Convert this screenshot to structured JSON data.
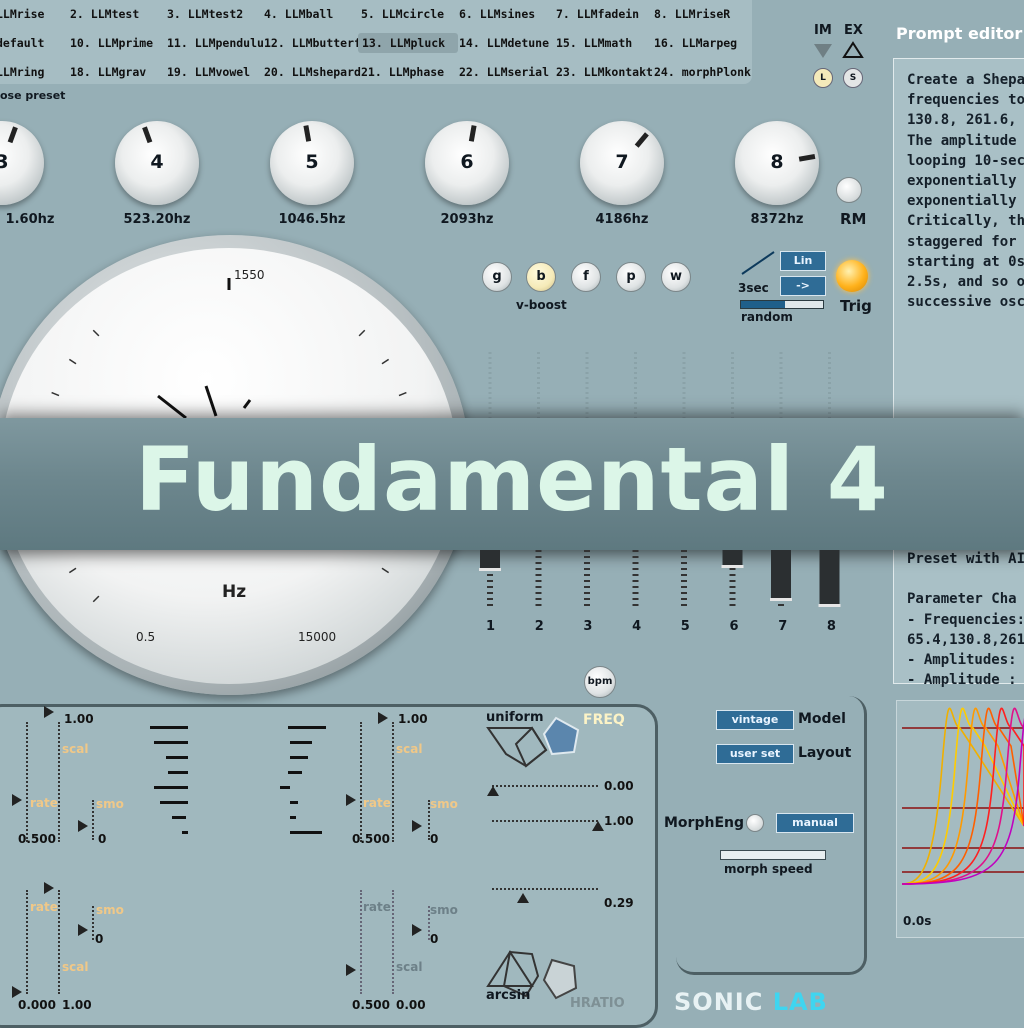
{
  "presets": [
    {
      "num": "",
      "name": "LLMrise"
    },
    {
      "num": "2.",
      "name": "LLMtest"
    },
    {
      "num": "3.",
      "name": "LLMtest2"
    },
    {
      "num": "4.",
      "name": "LLMball"
    },
    {
      "num": "5.",
      "name": "LLMcircle"
    },
    {
      "num": "6.",
      "name": "LLMsines"
    },
    {
      "num": "7.",
      "name": "LLMfadein"
    },
    {
      "num": "8.",
      "name": "LLMriseR"
    },
    {
      "num": "",
      "name": "default"
    },
    {
      "num": "10.",
      "name": "LLMprime"
    },
    {
      "num": "11.",
      "name": "LLMpendulu"
    },
    {
      "num": "12.",
      "name": "LLMbutterf"
    },
    {
      "num": "13.",
      "name": "LLMpluck"
    },
    {
      "num": "14.",
      "name": "LLMdetune"
    },
    {
      "num": "15.",
      "name": "LLMmath"
    },
    {
      "num": "16.",
      "name": "LLMarpeg"
    },
    {
      "num": "",
      "name": "LLMring"
    },
    {
      "num": "18.",
      "name": "LLMgrav"
    },
    {
      "num": "19.",
      "name": "LLMvowel"
    },
    {
      "num": "20.",
      "name": "LLMshepard"
    },
    {
      "num": "21.",
      "name": "LLMphase"
    },
    {
      "num": "22.",
      "name": "LLMserial"
    },
    {
      "num": "23.",
      "name": "LLMkontakt"
    },
    {
      "num": "24.",
      "name": "morphPlonk"
    }
  ],
  "selected_preset": "LLMpluck",
  "choose_preset_label": "ose preset",
  "im_label": "IM",
  "ex_label": "EX",
  "l_button": "L",
  "s_button": "S",
  "knobs": [
    {
      "num": "3",
      "freq": "1.60hz"
    },
    {
      "num": "4",
      "freq": "523.20hz"
    },
    {
      "num": "5",
      "freq": "1046.5hz"
    },
    {
      "num": "6",
      "freq": "2093hz"
    },
    {
      "num": "7",
      "freq": "4186hz"
    },
    {
      "num": "8",
      "freq": "8372hz"
    }
  ],
  "rm_label": "RM",
  "gauge": {
    "top_label": "1550",
    "unit": "Hz",
    "low_label": "0.5",
    "high_label": "15000"
  },
  "vboost": {
    "buttons": [
      "g",
      "b",
      "f",
      "p",
      "w"
    ],
    "active": "b",
    "label": "v-boost"
  },
  "lin_button": "Lin",
  "arrow_button": "->",
  "time_label": "3sec",
  "random_label": "random",
  "trig_label": "Trig",
  "prompt_editor": {
    "title": "Prompt editor",
    "lines": [
      "Create a Shepa",
      "frequencies to C",
      "130.8, 261.6, 52",
      "The amplitude o",
      "looping 10-seco",
      "exponentially to",
      "exponentially b",
      "Critically, the st",
      "staggered for e",
      "starting at 0s, o",
      "2.5s, and so on,",
      "successive osci"
    ],
    "lines2": [
      "Preset with AI c",
      "",
      "Parameter Cha",
      "- Frequencies:",
      "65.4,130.8,261.",
      "- Amplitudes: 0",
      "- Amplitude : 1"
    ]
  },
  "title_band": "Fundamental 4",
  "slider_numbers": [
    "1",
    "2",
    "3",
    "4",
    "5",
    "6",
    "7",
    "8"
  ],
  "bpm_label": "bpm",
  "lower": {
    "left_top_value": "1.00",
    "scal": "scal",
    "rate": "rate",
    "smo": "smo",
    "left_rate_value": "0.500",
    "left_smo_value": "0",
    "right_top_value": "1.00",
    "right_rate_value": "0.500",
    "right_smo_value": "0",
    "bottom_smo_left_value": "0",
    "bottom_left_values": [
      "0.000",
      "1.00"
    ],
    "bottom_right_values": [
      "0.500",
      "0.00"
    ],
    "bottom_smo_right_value": "0",
    "uniform": "uniform",
    "freq": "FREQ",
    "slider_vals": [
      "0.00",
      "1.00",
      "0.29"
    ],
    "arcsin": "arcsin",
    "hratio": "HRATIO"
  },
  "model": {
    "vintage": "vintage",
    "model_label": "Model",
    "user_set": "user set",
    "layout_label": "Layout",
    "morph_eng": "MorphEng",
    "manual": "manual",
    "morph_speed": "morph speed"
  },
  "brand": {
    "sonic": "SONIC",
    "lab": "LAB"
  },
  "graph_label": "0.0s",
  "colors": {
    "accent_orange": "#ffb21c",
    "title_text": "#dcf6e8",
    "button_blue": "#2f6c96",
    "brand_lab": "#3fd5f0"
  }
}
